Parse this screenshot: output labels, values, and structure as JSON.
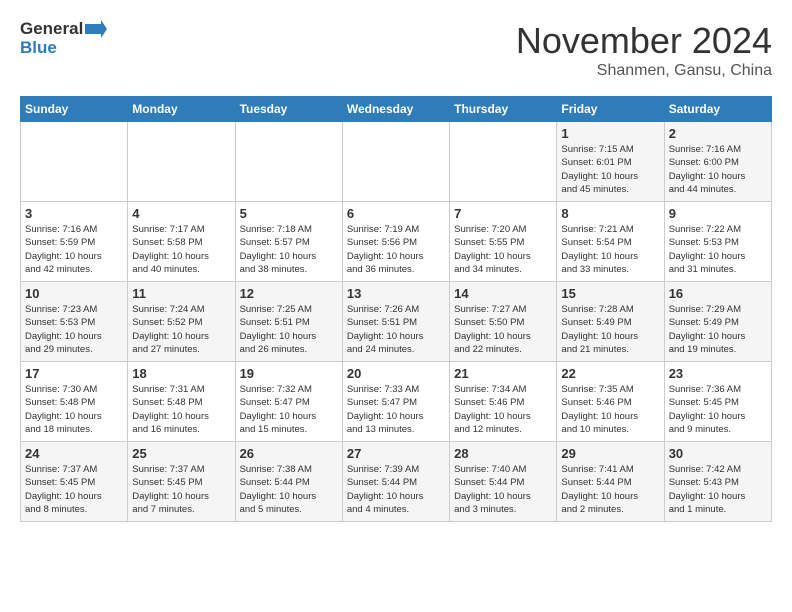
{
  "logo": {
    "line1": "General",
    "line2": "Blue"
  },
  "title": "November 2024",
  "subtitle": "Shanmen, Gansu, China",
  "days_header": [
    "Sunday",
    "Monday",
    "Tuesday",
    "Wednesday",
    "Thursday",
    "Friday",
    "Saturday"
  ],
  "weeks": [
    [
      {
        "num": "",
        "info": ""
      },
      {
        "num": "",
        "info": ""
      },
      {
        "num": "",
        "info": ""
      },
      {
        "num": "",
        "info": ""
      },
      {
        "num": "",
        "info": ""
      },
      {
        "num": "1",
        "info": "Sunrise: 7:15 AM\nSunset: 6:01 PM\nDaylight: 10 hours\nand 45 minutes."
      },
      {
        "num": "2",
        "info": "Sunrise: 7:16 AM\nSunset: 6:00 PM\nDaylight: 10 hours\nand 44 minutes."
      }
    ],
    [
      {
        "num": "3",
        "info": "Sunrise: 7:16 AM\nSunset: 5:59 PM\nDaylight: 10 hours\nand 42 minutes."
      },
      {
        "num": "4",
        "info": "Sunrise: 7:17 AM\nSunset: 5:58 PM\nDaylight: 10 hours\nand 40 minutes."
      },
      {
        "num": "5",
        "info": "Sunrise: 7:18 AM\nSunset: 5:57 PM\nDaylight: 10 hours\nand 38 minutes."
      },
      {
        "num": "6",
        "info": "Sunrise: 7:19 AM\nSunset: 5:56 PM\nDaylight: 10 hours\nand 36 minutes."
      },
      {
        "num": "7",
        "info": "Sunrise: 7:20 AM\nSunset: 5:55 PM\nDaylight: 10 hours\nand 34 minutes."
      },
      {
        "num": "8",
        "info": "Sunrise: 7:21 AM\nSunset: 5:54 PM\nDaylight: 10 hours\nand 33 minutes."
      },
      {
        "num": "9",
        "info": "Sunrise: 7:22 AM\nSunset: 5:53 PM\nDaylight: 10 hours\nand 31 minutes."
      }
    ],
    [
      {
        "num": "10",
        "info": "Sunrise: 7:23 AM\nSunset: 5:53 PM\nDaylight: 10 hours\nand 29 minutes."
      },
      {
        "num": "11",
        "info": "Sunrise: 7:24 AM\nSunset: 5:52 PM\nDaylight: 10 hours\nand 27 minutes."
      },
      {
        "num": "12",
        "info": "Sunrise: 7:25 AM\nSunset: 5:51 PM\nDaylight: 10 hours\nand 26 minutes."
      },
      {
        "num": "13",
        "info": "Sunrise: 7:26 AM\nSunset: 5:51 PM\nDaylight: 10 hours\nand 24 minutes."
      },
      {
        "num": "14",
        "info": "Sunrise: 7:27 AM\nSunset: 5:50 PM\nDaylight: 10 hours\nand 22 minutes."
      },
      {
        "num": "15",
        "info": "Sunrise: 7:28 AM\nSunset: 5:49 PM\nDaylight: 10 hours\nand 21 minutes."
      },
      {
        "num": "16",
        "info": "Sunrise: 7:29 AM\nSunset: 5:49 PM\nDaylight: 10 hours\nand 19 minutes."
      }
    ],
    [
      {
        "num": "17",
        "info": "Sunrise: 7:30 AM\nSunset: 5:48 PM\nDaylight: 10 hours\nand 18 minutes."
      },
      {
        "num": "18",
        "info": "Sunrise: 7:31 AM\nSunset: 5:48 PM\nDaylight: 10 hours\nand 16 minutes."
      },
      {
        "num": "19",
        "info": "Sunrise: 7:32 AM\nSunset: 5:47 PM\nDaylight: 10 hours\nand 15 minutes."
      },
      {
        "num": "20",
        "info": "Sunrise: 7:33 AM\nSunset: 5:47 PM\nDaylight: 10 hours\nand 13 minutes."
      },
      {
        "num": "21",
        "info": "Sunrise: 7:34 AM\nSunset: 5:46 PM\nDaylight: 10 hours\nand 12 minutes."
      },
      {
        "num": "22",
        "info": "Sunrise: 7:35 AM\nSunset: 5:46 PM\nDaylight: 10 hours\nand 10 minutes."
      },
      {
        "num": "23",
        "info": "Sunrise: 7:36 AM\nSunset: 5:45 PM\nDaylight: 10 hours\nand 9 minutes."
      }
    ],
    [
      {
        "num": "24",
        "info": "Sunrise: 7:37 AM\nSunset: 5:45 PM\nDaylight: 10 hours\nand 8 minutes."
      },
      {
        "num": "25",
        "info": "Sunrise: 7:37 AM\nSunset: 5:45 PM\nDaylight: 10 hours\nand 7 minutes."
      },
      {
        "num": "26",
        "info": "Sunrise: 7:38 AM\nSunset: 5:44 PM\nDaylight: 10 hours\nand 5 minutes."
      },
      {
        "num": "27",
        "info": "Sunrise: 7:39 AM\nSunset: 5:44 PM\nDaylight: 10 hours\nand 4 minutes."
      },
      {
        "num": "28",
        "info": "Sunrise: 7:40 AM\nSunset: 5:44 PM\nDaylight: 10 hours\nand 3 minutes."
      },
      {
        "num": "29",
        "info": "Sunrise: 7:41 AM\nSunset: 5:44 PM\nDaylight: 10 hours\nand 2 minutes."
      },
      {
        "num": "30",
        "info": "Sunrise: 7:42 AM\nSunset: 5:43 PM\nDaylight: 10 hours\nand 1 minute."
      }
    ]
  ]
}
